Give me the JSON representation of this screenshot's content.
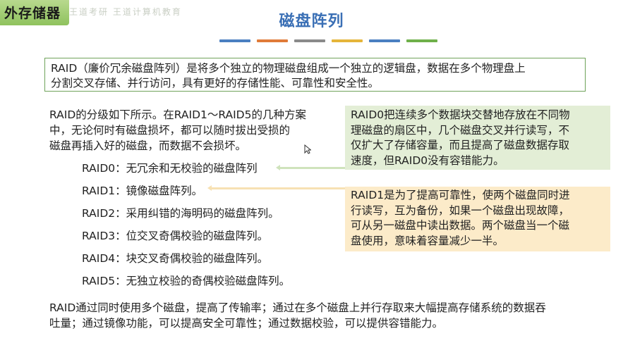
{
  "corner": {
    "title": "外存储器",
    "subtitle": "王道考研 王道计算机教育"
  },
  "header": {
    "title": "磁盘阵列"
  },
  "color_strip": [
    "#4a7fc1",
    "#e07b39",
    "#8a8a8a",
    "#e5b53a",
    "#4a7fc1",
    "#6fb04a"
  ],
  "intro": {
    "line1": "RAID（廉价冗余磁盘阵列）是将多个独立的物理磁盘组成一个独立的逻辑盘，数据在多个物理盘上",
    "line2": "分割交叉存储、并行访问，具有更好的存储性能、可靠性和安全性。"
  },
  "levels": {
    "line1": "RAID的分级如下所示。在RAID1～RAID5的几种方案",
    "line2": "中，无论何时有磁盘损坏，都可以随时拔出受损的",
    "line3": "磁盘再插入好的磁盘，而数据不会损坏。"
  },
  "raid_list": [
    "RAID0：无冗余和无校验的磁盘阵列",
    "RAID1：镜像磁盘阵列。",
    "RAID2：采用纠错的海明码的磁盘阵列。",
    "RAID3：位交叉奇偶校验的磁盘阵列。",
    "RAID4：块交叉奇偶校验的磁盘阵列。",
    "RAID5：无独立校验的奇偶校验磁盘阵列。"
  ],
  "note_raid0": {
    "line1": "RAID0把连续多个数据块交替地存放在不同物",
    "line2": "理磁盘的扇区中，几个磁盘交叉并行读写，不",
    "line3": "仅扩大了存储容量，而且提高了磁盘数据存取",
    "line4": "速度，但RAID0没有容错能力。"
  },
  "note_raid1": {
    "line1": "RAID1是为了提高可靠性，使两个磁盘同时进",
    "line2": "行读写，互为备份，如果一个磁盘出现故障，",
    "line3": "可从另一磁盘中读出数据。两个磁盘当一个磁",
    "line4": "盘使用，意味着容量减少一半。"
  },
  "summary": {
    "line1": "RAID通过同时使用多个磁盘，提高了传输率；通过在多个磁盘上并行存取来大幅提高存储系统的数据吞",
    "line2": "吐量；通过镜像功能，可以提高安全可靠性；通过数据校验，可以提供容错能力。"
  }
}
